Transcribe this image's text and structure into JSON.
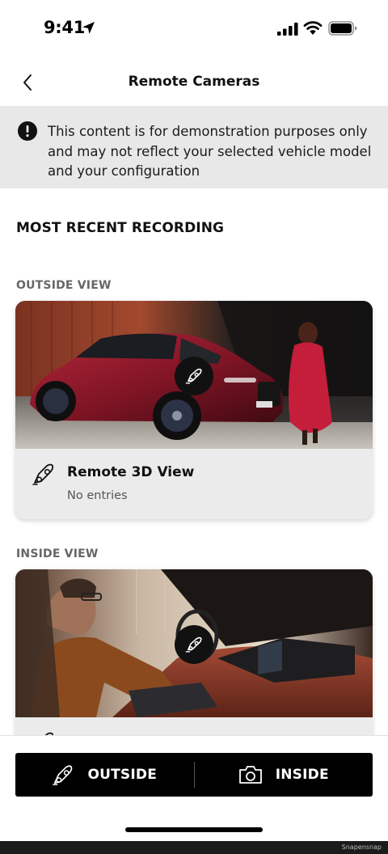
{
  "status_bar": {
    "time": "9:41"
  },
  "header": {
    "title": "Remote Cameras"
  },
  "notice": {
    "text": "This content is for demonstration purposes only and may not reflect your selected vehicle model and your configuration"
  },
  "section": {
    "heading": "MOST RECENT RECORDING"
  },
  "outside": {
    "label": "OUTSIDE VIEW",
    "card_title": "Remote 3D View",
    "card_subtitle": "No entries"
  },
  "inside": {
    "label": "INSIDE VIEW"
  },
  "actions": {
    "outside_label": "OUTSIDE",
    "inside_label": "INSIDE"
  },
  "watermark": "Snapensnap"
}
